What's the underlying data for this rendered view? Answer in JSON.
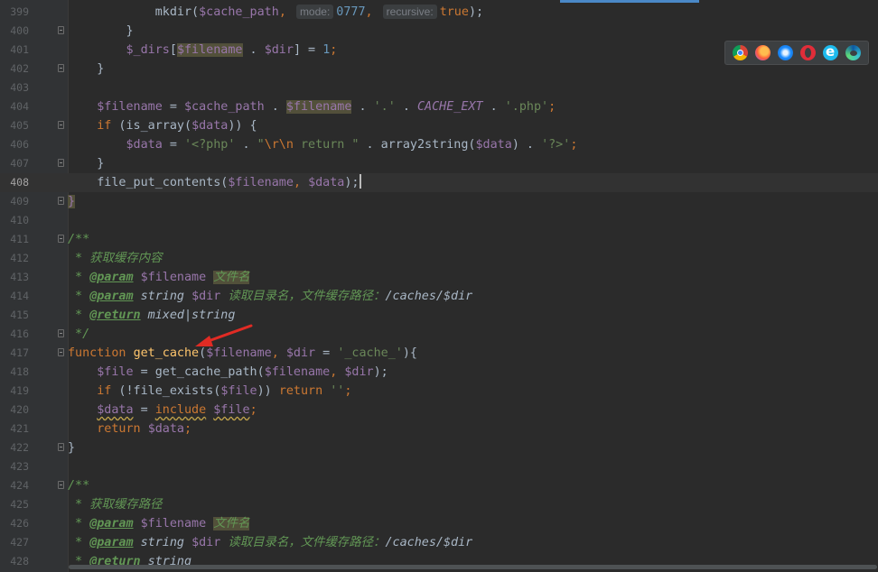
{
  "editor": {
    "current_line": "408",
    "lines": [
      {
        "n": "399",
        "fold": false,
        "current": false,
        "parts": [
          {
            "t": "            ",
            "c": "plain"
          },
          {
            "t": "mkdir(",
            "c": "plain"
          },
          {
            "t": "$cache_path",
            "c": "var"
          },
          {
            "t": ", ",
            "c": "kw"
          },
          {
            "t": "mode:",
            "c": "hint"
          },
          {
            "t": "0777",
            "c": "num"
          },
          {
            "t": ", ",
            "c": "kw"
          },
          {
            "t": "recursive:",
            "c": "hint"
          },
          {
            "t": "true",
            "c": "kw"
          },
          {
            "t": ");",
            "c": "plain"
          }
        ]
      },
      {
        "n": "400",
        "fold": true,
        "current": false,
        "parts": [
          {
            "t": "        }",
            "c": "plain"
          }
        ]
      },
      {
        "n": "401",
        "fold": false,
        "current": false,
        "parts": [
          {
            "t": "        ",
            "c": "plain"
          },
          {
            "t": "$_dirs",
            "c": "var"
          },
          {
            "t": "[",
            "c": "plain"
          },
          {
            "t": "$filename",
            "c": "hlvar"
          },
          {
            "t": " . ",
            "c": "plain"
          },
          {
            "t": "$dir",
            "c": "var"
          },
          {
            "t": "] = ",
            "c": "plain"
          },
          {
            "t": "1",
            "c": "num"
          },
          {
            "t": ";",
            "c": "kw"
          }
        ]
      },
      {
        "n": "402",
        "fold": true,
        "current": false,
        "parts": [
          {
            "t": "    }",
            "c": "plain"
          }
        ]
      },
      {
        "n": "403",
        "fold": false,
        "current": false,
        "parts": []
      },
      {
        "n": "404",
        "fold": false,
        "current": false,
        "parts": [
          {
            "t": "    ",
            "c": "plain"
          },
          {
            "t": "$filename",
            "c": "var"
          },
          {
            "t": " = ",
            "c": "plain"
          },
          {
            "t": "$cache_path",
            "c": "var"
          },
          {
            "t": " . ",
            "c": "plain"
          },
          {
            "t": "$filename",
            "c": "hlvar"
          },
          {
            "t": " . ",
            "c": "plain"
          },
          {
            "t": "'.'",
            "c": "str"
          },
          {
            "t": " . ",
            "c": "plain"
          },
          {
            "t": "CACHE_EXT",
            "c": "const"
          },
          {
            "t": " . ",
            "c": "plain"
          },
          {
            "t": "'.php'",
            "c": "str"
          },
          {
            "t": ";",
            "c": "kw"
          }
        ]
      },
      {
        "n": "405",
        "fold": true,
        "current": false,
        "parts": [
          {
            "t": "    ",
            "c": "plain"
          },
          {
            "t": "if",
            "c": "kw"
          },
          {
            "t": " (is_array(",
            "c": "plain"
          },
          {
            "t": "$data",
            "c": "var"
          },
          {
            "t": ")) {",
            "c": "plain"
          }
        ]
      },
      {
        "n": "406",
        "fold": false,
        "current": false,
        "parts": [
          {
            "t": "        ",
            "c": "plain"
          },
          {
            "t": "$data",
            "c": "var"
          },
          {
            "t": " = ",
            "c": "plain"
          },
          {
            "t": "'<?php'",
            "c": "str"
          },
          {
            "t": " . ",
            "c": "plain"
          },
          {
            "t": "\"",
            "c": "str"
          },
          {
            "t": "\\r\\n",
            "c": "esc"
          },
          {
            "t": " return \"",
            "c": "str"
          },
          {
            "t": " . array2string(",
            "c": "plain"
          },
          {
            "t": "$data",
            "c": "var"
          },
          {
            "t": ") . ",
            "c": "plain"
          },
          {
            "t": "'?>'",
            "c": "str"
          },
          {
            "t": ";",
            "c": "kw"
          }
        ]
      },
      {
        "n": "407",
        "fold": true,
        "current": false,
        "parts": [
          {
            "t": "    }",
            "c": "plain"
          }
        ]
      },
      {
        "n": "408",
        "fold": false,
        "current": true,
        "parts": [
          {
            "t": "    ",
            "c": "plain"
          },
          {
            "t": "file_put_contents(",
            "c": "plain"
          },
          {
            "t": "$filename",
            "c": "var"
          },
          {
            "t": ", ",
            "c": "kw"
          },
          {
            "t": "$data",
            "c": "var"
          },
          {
            "t": ");",
            "c": "plain"
          },
          {
            "t": "",
            "c": "caret"
          }
        ]
      },
      {
        "n": "409",
        "fold": true,
        "current": false,
        "parts": [
          {
            "t": "}",
            "c": "hlvar"
          }
        ]
      },
      {
        "n": "410",
        "fold": false,
        "current": false,
        "parts": []
      },
      {
        "n": "411",
        "fold": true,
        "current": false,
        "parts": [
          {
            "t": "/**",
            "c": "cmt"
          }
        ]
      },
      {
        "n": "412",
        "fold": false,
        "current": false,
        "parts": [
          {
            "t": " * 获取缓存内容",
            "c": "cmt"
          }
        ]
      },
      {
        "n": "413",
        "fold": false,
        "current": false,
        "parts": [
          {
            "t": " * ",
            "c": "cmt"
          },
          {
            "t": "@param",
            "c": "tag"
          },
          {
            "t": " ",
            "c": "cmt"
          },
          {
            "t": "$filename",
            "c": "var"
          },
          {
            "t": " ",
            "c": "cmt"
          },
          {
            "t": "文件名",
            "c": "hlcmt"
          }
        ]
      },
      {
        "n": "414",
        "fold": false,
        "current": false,
        "parts": [
          {
            "t": " * ",
            "c": "cmt"
          },
          {
            "t": "@param",
            "c": "tag"
          },
          {
            "t": " string ",
            "c": "doctype"
          },
          {
            "t": "$dir",
            "c": "var"
          },
          {
            "t": " 读取目录名，文件缓存路径：",
            "c": "cmt"
          },
          {
            "t": "/caches/$dir",
            "c": "doctype"
          }
        ]
      },
      {
        "n": "415",
        "fold": false,
        "current": false,
        "parts": [
          {
            "t": " * ",
            "c": "cmt"
          },
          {
            "t": "@return",
            "c": "tag"
          },
          {
            "t": " mixed|string",
            "c": "doctype"
          }
        ]
      },
      {
        "n": "416",
        "fold": true,
        "current": false,
        "parts": [
          {
            "t": " */",
            "c": "cmt"
          }
        ]
      },
      {
        "n": "417",
        "fold": true,
        "current": false,
        "parts": [
          {
            "t": "function",
            "c": "kw"
          },
          {
            "t": " ",
            "c": "plain"
          },
          {
            "t": "get_cache",
            "c": "fn"
          },
          {
            "t": "(",
            "c": "plain"
          },
          {
            "t": "$filename",
            "c": "var"
          },
          {
            "t": ", ",
            "c": "kw"
          },
          {
            "t": "$dir",
            "c": "var"
          },
          {
            "t": " = ",
            "c": "plain"
          },
          {
            "t": "'_cache_'",
            "c": "str"
          },
          {
            "t": "){",
            "c": "plain"
          }
        ]
      },
      {
        "n": "418",
        "fold": false,
        "current": false,
        "parts": [
          {
            "t": "    ",
            "c": "plain"
          },
          {
            "t": "$file",
            "c": "var"
          },
          {
            "t": " = get_cache_path(",
            "c": "plain"
          },
          {
            "t": "$filename",
            "c": "var"
          },
          {
            "t": ", ",
            "c": "kw"
          },
          {
            "t": "$dir",
            "c": "var"
          },
          {
            "t": ");",
            "c": "plain"
          }
        ]
      },
      {
        "n": "419",
        "fold": false,
        "current": false,
        "parts": [
          {
            "t": "    ",
            "c": "plain"
          },
          {
            "t": "if",
            "c": "kw"
          },
          {
            "t": " (!file_exists(",
            "c": "plain"
          },
          {
            "t": "$file",
            "c": "var"
          },
          {
            "t": ")) ",
            "c": "plain"
          },
          {
            "t": "return",
            "c": "kw"
          },
          {
            "t": " ",
            "c": "plain"
          },
          {
            "t": "''",
            "c": "str"
          },
          {
            "t": ";",
            "c": "kw"
          }
        ]
      },
      {
        "n": "420",
        "fold": false,
        "current": false,
        "parts": [
          {
            "t": "    ",
            "c": "plain"
          },
          {
            "t": "$data",
            "c": "var wavy"
          },
          {
            "t": " = ",
            "c": "plain"
          },
          {
            "t": "include",
            "c": "kw wavy"
          },
          {
            "t": " ",
            "c": "plain"
          },
          {
            "t": "$file",
            "c": "var wavy"
          },
          {
            "t": ";",
            "c": "kw"
          }
        ]
      },
      {
        "n": "421",
        "fold": false,
        "current": false,
        "parts": [
          {
            "t": "    ",
            "c": "plain"
          },
          {
            "t": "return",
            "c": "kw"
          },
          {
            "t": " ",
            "c": "plain"
          },
          {
            "t": "$data",
            "c": "var"
          },
          {
            "t": ";",
            "c": "kw"
          }
        ]
      },
      {
        "n": "422",
        "fold": true,
        "current": false,
        "parts": [
          {
            "t": "}",
            "c": "plain"
          }
        ]
      },
      {
        "n": "423",
        "fold": false,
        "current": false,
        "parts": []
      },
      {
        "n": "424",
        "fold": true,
        "current": false,
        "parts": [
          {
            "t": "/**",
            "c": "cmt"
          }
        ]
      },
      {
        "n": "425",
        "fold": false,
        "current": false,
        "parts": [
          {
            "t": " * 获取缓存路径",
            "c": "cmt"
          }
        ]
      },
      {
        "n": "426",
        "fold": false,
        "current": false,
        "parts": [
          {
            "t": " * ",
            "c": "cmt"
          },
          {
            "t": "@param",
            "c": "tag"
          },
          {
            "t": " ",
            "c": "cmt"
          },
          {
            "t": "$filename",
            "c": "var"
          },
          {
            "t": " ",
            "c": "cmt"
          },
          {
            "t": "文件名",
            "c": "hlcmt"
          }
        ]
      },
      {
        "n": "427",
        "fold": false,
        "current": false,
        "parts": [
          {
            "t": " * ",
            "c": "cmt"
          },
          {
            "t": "@param",
            "c": "tag"
          },
          {
            "t": " string ",
            "c": "doctype"
          },
          {
            "t": "$dir",
            "c": "var"
          },
          {
            "t": " 读取目录名，文件缓存路径：",
            "c": "cmt"
          },
          {
            "t": "/caches/$dir",
            "c": "doctype"
          }
        ]
      },
      {
        "n": "428",
        "fold": false,
        "current": false,
        "parts": [
          {
            "t": " * ",
            "c": "cmt"
          },
          {
            "t": "@return",
            "c": "tag"
          },
          {
            "t": " string",
            "c": "doctype"
          }
        ]
      }
    ]
  },
  "browser_bar": {
    "icons": [
      "chrome-icon",
      "firefox-icon",
      "safari-icon",
      "opera-icon",
      "ie-icon",
      "edge-icon"
    ]
  },
  "annotation": {
    "arrow_color": "#e02b24"
  }
}
